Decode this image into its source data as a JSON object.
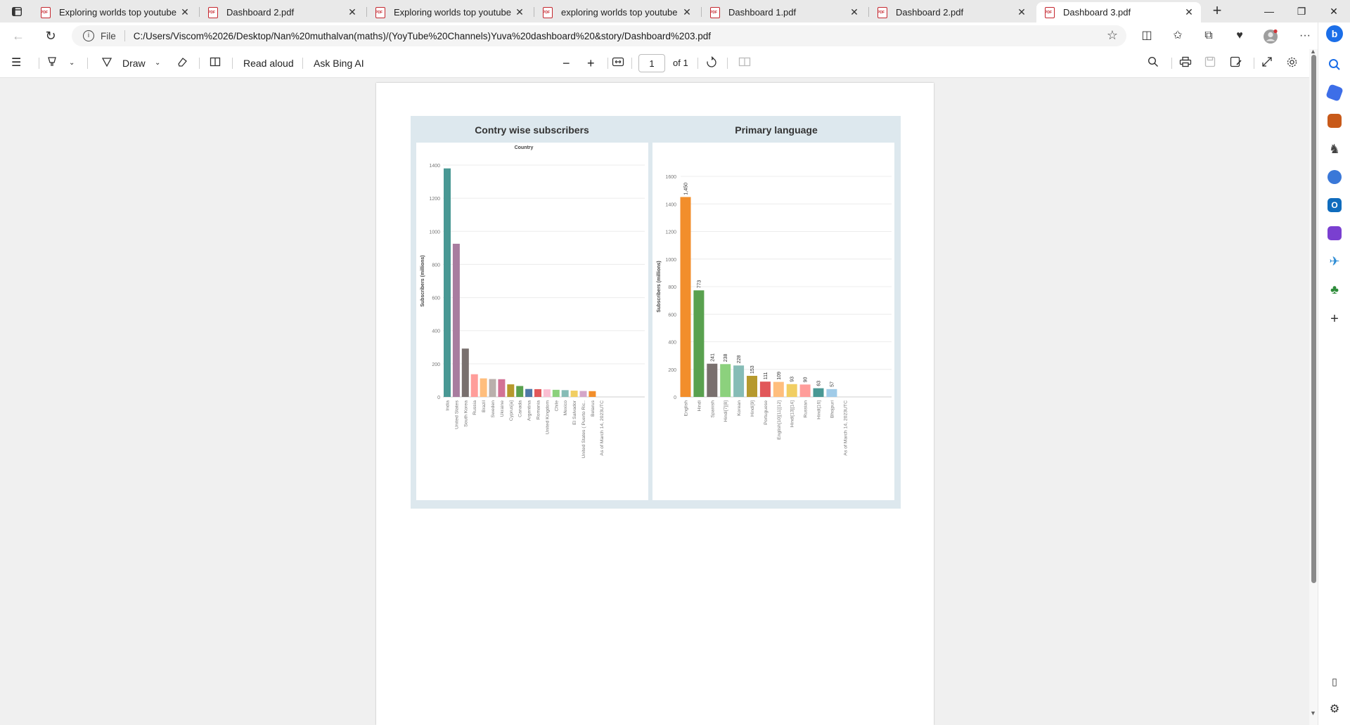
{
  "browser": {
    "tabs": [
      {
        "title": "Exploring worlds top youtube ch",
        "active": false
      },
      {
        "title": "Dashboard 2.pdf",
        "active": false
      },
      {
        "title": "Exploring worlds top youtube ch",
        "active": false
      },
      {
        "title": "exploring worlds top youtube ch",
        "active": false
      },
      {
        "title": "Dashboard 1.pdf",
        "active": false
      },
      {
        "title": "Dashboard 2.pdf",
        "active": false
      },
      {
        "title": "Dashboard 3.pdf",
        "active": true
      }
    ],
    "address": {
      "scheme": "File",
      "url": "C:/Users/Viscom%2026/Desktop/Nan%20muthalvan(maths)/(YoyTube%20Channels)Yuva%20dashboard%20&story/Dashboard%203.pdf"
    }
  },
  "pdf_toolbar": {
    "draw_label": "Draw",
    "read_aloud_label": "Read aloud",
    "ask_ai_label": "Ask Bing AI",
    "page_number": "1",
    "page_total": "of 1"
  },
  "dashboard": {
    "left_title": "Contry wise subscribers",
    "right_title": "Primary language"
  },
  "chart_data": [
    {
      "type": "bar",
      "title": "Contry wise subscribers",
      "subtitle": "Country",
      "xlabel": "",
      "ylabel": "Subscribers (millions)",
      "ylim": [
        0,
        1400
      ],
      "yticks": [
        0,
        200,
        400,
        600,
        800,
        1000,
        1200,
        1400
      ],
      "grid": true,
      "categories": [
        "India",
        "United States",
        "South Korea",
        "Russia",
        "Brazil",
        "Sweden",
        "Ukraine",
        "Cyprus[a]",
        "Canada",
        "Argentina",
        "Romania",
        "United Kingdom",
        "Chile",
        "Mexico",
        "El Salvador",
        "United States ( Puerto Ric..",
        "Belarus",
        "As of March 14, 2023UTC"
      ],
      "values": [
        1380,
        925,
        292,
        137,
        112,
        108,
        107,
        76,
        66,
        48,
        47,
        46,
        43,
        41,
        38,
        36,
        35,
        0
      ],
      "colors": [
        "#499894",
        "#a87c9f",
        "#79706e",
        "#ff9d9a",
        "#ffbe7d",
        "#bab0ac",
        "#d37295",
        "#b6992d",
        "#59a14f",
        "#4e79a7",
        "#e15759",
        "#fabfd2",
        "#8cd17d",
        "#86bcb6",
        "#f1ce63",
        "#d4a6c8",
        "#f28e2b",
        "#9d7660"
      ]
    },
    {
      "type": "bar",
      "title": "Primary language",
      "xlabel": "",
      "ylabel": "Subscribers (millions)",
      "ylim": [
        0,
        1600
      ],
      "yticks": [
        0,
        200,
        400,
        600,
        800,
        1000,
        1200,
        1400,
        1600
      ],
      "grid": true,
      "categories": [
        "English",
        "Hindi",
        "Spanish",
        "Hindi[7][8]",
        "Korean",
        "Hindi[9]",
        "Portuguese",
        "English[10][11][12]",
        "Hindi[13][14]",
        "Russian",
        "Hindi[16]",
        "Bhojpuri",
        "As of March 14, 2023UTC"
      ],
      "values": [
        1450,
        773,
        241,
        238,
        228,
        153,
        111,
        109,
        93,
        90,
        63,
        57,
        null
      ],
      "labels": [
        "1,450",
        "773",
        "241",
        "238",
        "228",
        "153",
        "111",
        "109",
        "93",
        "90",
        "63",
        "57",
        ""
      ],
      "colors": [
        "#f28e2b",
        "#59a14f",
        "#79706e",
        "#8cd17d",
        "#86bcb6",
        "#b6992d",
        "#e15759",
        "#ffbe7d",
        "#f1ce63",
        "#ff9d9a",
        "#499894",
        "#a0cbe8",
        "#bab0ac"
      ]
    }
  ]
}
